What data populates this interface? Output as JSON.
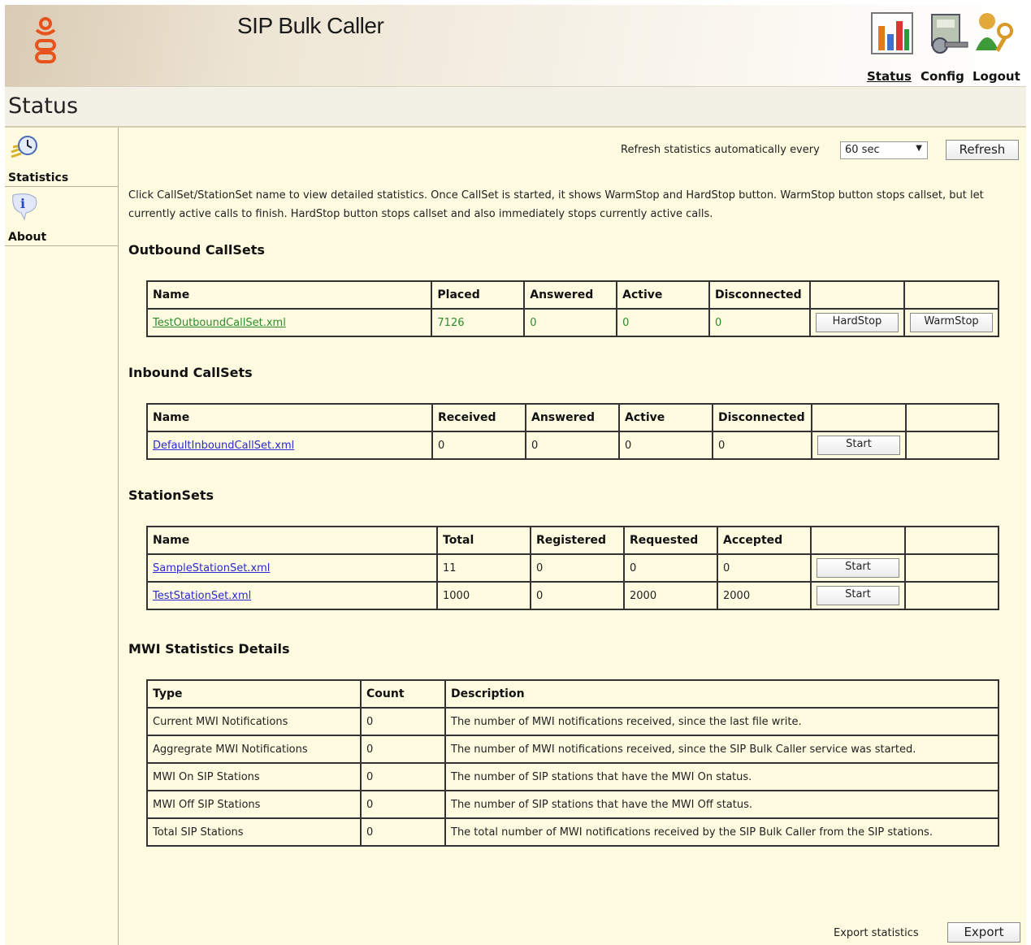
{
  "app": {
    "title": "SIP Bulk Caller",
    "nav": {
      "status": "Status",
      "config": "Config",
      "logout": "Logout"
    },
    "page_title": "Status"
  },
  "sidebar": {
    "items": [
      {
        "label": "Statistics",
        "icon": "clock-icon"
      },
      {
        "label": "About",
        "icon": "info-icon"
      }
    ]
  },
  "refresh": {
    "label": "Refresh statistics automatically every",
    "interval": "60 sec",
    "button": "Refresh"
  },
  "info_text": "Click CallSet/StationSet name to view detailed statistics. Once CallSet is started, it shows WarmStop and HardStop button. WarmStop button stops callset, but let currently active calls to finish. HardStop button stops callset and also immediately stops currently active calls.",
  "outbound": {
    "title": "Outbound CallSets",
    "headers": [
      "Name",
      "Placed",
      "Answered",
      "Active",
      "Disconnected"
    ],
    "row": {
      "name": "TestOutboundCallSet.xml",
      "placed": "7126",
      "answered": "0",
      "active": "0",
      "disconnected": "0"
    },
    "hardstop": "HardStop",
    "warmstop": "WarmStop"
  },
  "inbound": {
    "title": "Inbound CallSets",
    "headers": [
      "Name",
      "Received",
      "Answered",
      "Active",
      "Disconnected"
    ],
    "row": {
      "name": "DefaultInboundCallSet.xml",
      "received": "0",
      "answered": "0",
      "active": "0",
      "disconnected": "0"
    },
    "start": "Start"
  },
  "stations": {
    "title": "StationSets",
    "headers": [
      "Name",
      "Total",
      "Registered",
      "Requested",
      "Accepted"
    ],
    "rows": [
      {
        "name": "SampleStationSet.xml",
        "total": "11",
        "registered": "0",
        "requested": "0",
        "accepted": "0"
      },
      {
        "name": "TestStationSet.xml",
        "total": "1000",
        "registered": "0",
        "requested": "2000",
        "accepted": "2000"
      }
    ],
    "start": "Start"
  },
  "mwi": {
    "title": "MWI Statistics Details",
    "headers": [
      "Type",
      "Count",
      "Description"
    ],
    "rows": [
      {
        "type": "Current MWI Notifications",
        "count": "0",
        "description": "The number of MWI notifications received, since the last file write."
      },
      {
        "type": "Aggregrate MWI Notifications",
        "count": "0",
        "description": "The number of MWI notifications received, since the SIP Bulk Caller service was started."
      },
      {
        "type": "MWI On SIP Stations",
        "count": "0",
        "description": "The number of SIP stations that have the MWI On status."
      },
      {
        "type": "MWI Off SIP Stations",
        "count": "0",
        "description": "The number of SIP stations that have the MWI Off status."
      },
      {
        "type": "Total SIP Stations",
        "count": "0",
        "description": "The total number of MWI notifications received by the SIP Bulk Caller from the SIP stations."
      }
    ]
  },
  "export": {
    "label": "Export statistics",
    "button": "Export"
  },
  "colors": {
    "accent": "#e8521d",
    "background": "#fefbe0",
    "link": "#2a2ad0",
    "green_value": "#2c8d2c"
  }
}
